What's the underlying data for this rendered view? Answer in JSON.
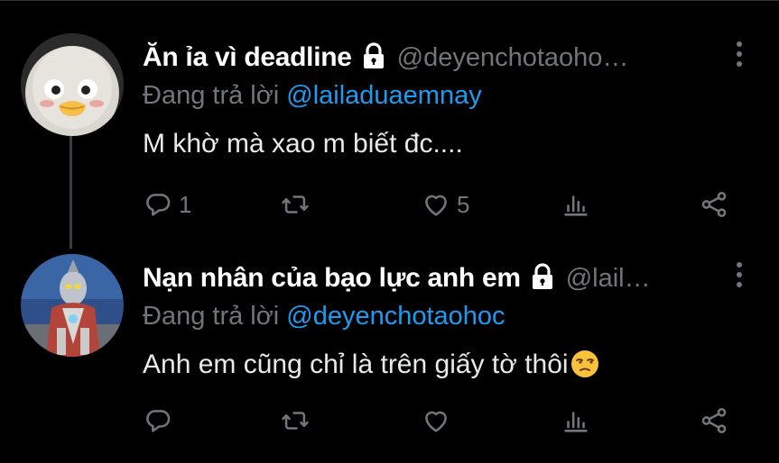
{
  "tweets": [
    {
      "author_name": "Ăn ỉa vì deadline",
      "handle": "@deyenchotaoho…",
      "replying_prefix": "Đang trả lời",
      "replying_to": "@lailaduaemnay",
      "text": "M khờ mà xao m biết đc....",
      "reply_count": "1",
      "retweet_count": "",
      "like_count": "5"
    },
    {
      "author_name": "Nạn nhân của bạo lực anh em",
      "handle": "@lail…",
      "replying_prefix": "Đang trả lời",
      "replying_to": "@deyenchotaohoc",
      "text": "Anh em cũng chỉ là trên giấy tờ thôi",
      "reply_count": "",
      "retweet_count": "",
      "like_count": ""
    }
  ],
  "colors": {
    "background": "#000000",
    "text": "#e7e9ea",
    "secondary": "#71767b",
    "link": "#1d9bf0"
  },
  "icons": [
    "lock-icon",
    "more-icon",
    "reply-icon",
    "retweet-icon",
    "like-icon",
    "views-icon",
    "share-icon",
    "unamused-face-emoji"
  ]
}
